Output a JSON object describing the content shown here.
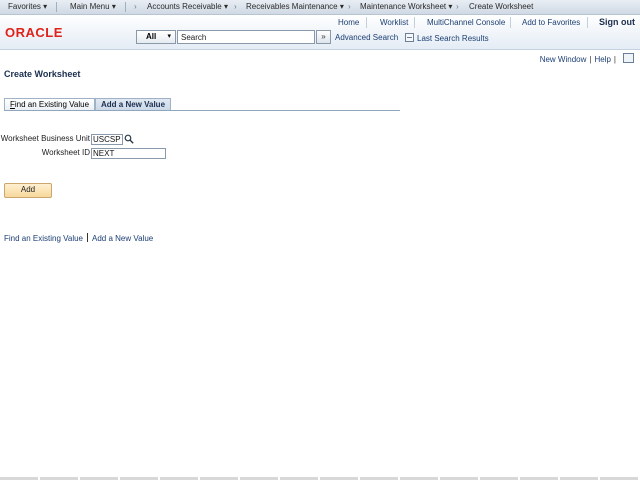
{
  "nav": {
    "favorites": "Favorites",
    "main_menu": "Main Menu",
    "accounts_receivable": "Accounts Receivable",
    "receivables_maintenance": "Receivables Maintenance",
    "maintenance_worksheet": "Maintenance Worksheet",
    "create_worksheet": "Create Worksheet",
    "caret": "▾",
    "arrow": "›"
  },
  "header": {
    "logo": "ORACLE",
    "links": {
      "home": "Home",
      "worklist": "Worklist",
      "multichannel": "MultiChannel Console",
      "add_favorites": "Add to Favorites",
      "sign_out": "Sign out"
    },
    "search": {
      "scope": "All",
      "value": "Search",
      "go": "»",
      "advanced": "Advanced Search",
      "last_results": "Last Search Results"
    }
  },
  "pagelinks": {
    "new_window": "New Window",
    "sep": "|",
    "help": "Help",
    "sep2": "|"
  },
  "page": {
    "title": "Create Worksheet"
  },
  "tabs": {
    "find_prefix": "F",
    "find_rest": "ind an Existing Value",
    "add": "Add a New Value"
  },
  "form": {
    "bu_label": "Worksheet Business Unit",
    "bu_value": "USCSP",
    "id_label": "Worksheet ID",
    "id_value": "NEXT"
  },
  "buttons": {
    "add": "Add"
  },
  "bottom": {
    "find": "Find an Existing Value",
    "add": "Add a New Value"
  },
  "colors": {
    "logo": "#e0231a",
    "link": "#1c3f73",
    "title": "#1c2f4e",
    "add_button": "#f7d79c"
  }
}
